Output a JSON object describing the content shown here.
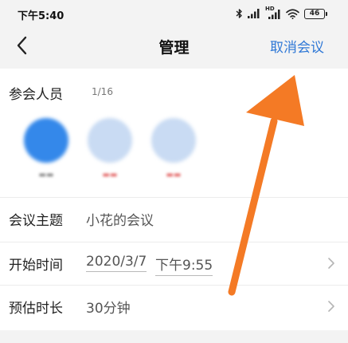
{
  "status_bar": {
    "time": "下午5:40",
    "network_label": "HD",
    "battery_level": "46",
    "icons": [
      "bluetooth-icon",
      "signal-icon",
      "signal-hd-icon",
      "wifi-icon",
      "battery-icon"
    ]
  },
  "nav": {
    "back_icon": "chevron-left-icon",
    "title": "管理",
    "cancel_label": "取消会议"
  },
  "participants": {
    "title": "参会人员",
    "count": "1/16",
    "avatars": [
      {
        "role": "host",
        "icon": "avatar-host-icon"
      },
      {
        "role": "guest",
        "icon": "avatar-guest-icon"
      },
      {
        "role": "guest",
        "icon": "avatar-guest-icon"
      }
    ]
  },
  "form": {
    "topic": {
      "label": "会议主题",
      "value": "小花的会议"
    },
    "start_time": {
      "label": "开始时间",
      "date": "2020/3/7",
      "time": "下午9:55",
      "chevron": "chevron-right-icon"
    },
    "duration": {
      "label": "预估时长",
      "value": "30分钟",
      "chevron": "chevron-right-icon"
    }
  },
  "colors": {
    "accent": "#2f78d6",
    "arrow": "#f47a25",
    "host_avatar": "#3488ea",
    "guest_avatar": "#c9dbf3",
    "background_gray": "#f3f3f3"
  }
}
